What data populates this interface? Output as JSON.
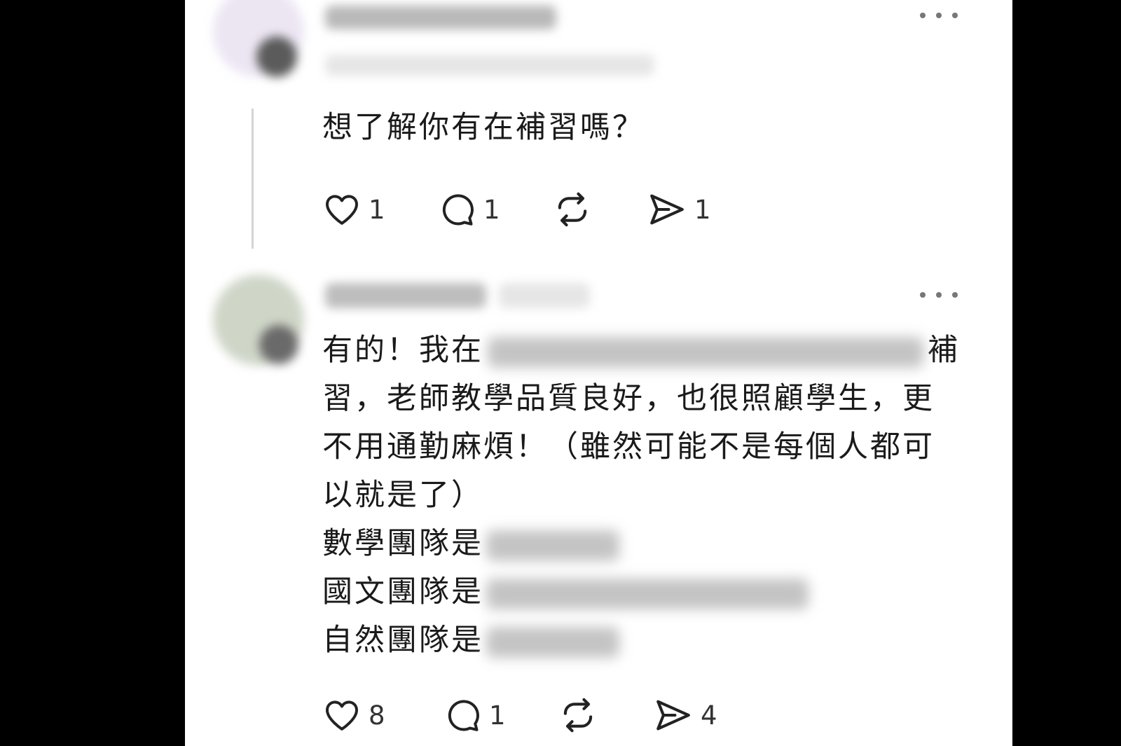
{
  "post1": {
    "text": "想了解你有在補習嗎？",
    "likes": "1",
    "comments": "1",
    "shares": "1"
  },
  "post2": {
    "line1_start": "有的！我在",
    "line1_end": "補",
    "line2": "習，老師教學品質良好，也很照顧學生，更",
    "line3": "不用通勤麻煩！（雖然可能不是每個人都可",
    "line4": "以就是了）",
    "math": "數學團隊是",
    "chinese": "國文團隊是",
    "science": "自然團隊是",
    "likes": "8",
    "comments": "1",
    "shares": "4"
  },
  "icons": {
    "more": "more-icon",
    "like": "heart-icon",
    "comment": "comment-icon",
    "repost": "repost-icon",
    "share": "send-icon"
  }
}
